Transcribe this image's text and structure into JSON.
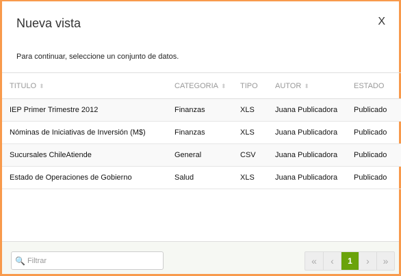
{
  "dialog": {
    "title": "Nueva vista",
    "close": "X",
    "subtitle": "Para continuar, seleccione un conjunto de datos."
  },
  "table": {
    "headers": [
      "TITULO",
      "CATEGORIA",
      "TIPO",
      "AUTOR",
      "ESTADO"
    ],
    "rows": [
      [
        "IEP Primer Trimestre 2012",
        "Finanzas",
        "XLS",
        "Juana Publicadora",
        "Publicado"
      ],
      [
        "Nóminas de Iniciativas de Inversión (M$)",
        "Finanzas",
        "XLS",
        "Juana Publicadora",
        "Publicado"
      ],
      [
        "Sucursales ChileAtiende",
        "General",
        "CSV",
        "Juana Publicadora",
        "Publicado"
      ],
      [
        "Estado de Operaciones de Gobierno",
        "Salud",
        "XLS",
        "Juana Publicadora",
        "Publicado"
      ]
    ]
  },
  "footer": {
    "filter_placeholder": "Filtrar",
    "pager": {
      "first": "«",
      "prev": "‹",
      "current": "1",
      "next": "›",
      "last": "»"
    }
  },
  "colors": {
    "border": "#f89a4c",
    "active_page": "#6aa30b"
  }
}
